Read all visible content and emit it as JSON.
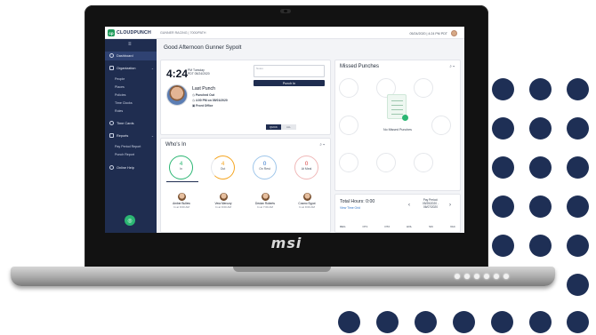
{
  "device": {
    "brand": "msi"
  },
  "app": {
    "logo_mark": "cp",
    "logo_text": "CLOUDPUNCH",
    "breadcrumb": "GUNNER RACING | 7000/PATH",
    "datetime": "05/24/2020 | 4:24 PM PDT",
    "greeting": "Good Afternoon Gunner Sypolt"
  },
  "sidebar": {
    "menu_glyph": "≡",
    "items": [
      {
        "label": "Dashboard"
      },
      {
        "label": "Organization"
      },
      {
        "label": "People"
      },
      {
        "label": "Places"
      },
      {
        "label": "Policies"
      },
      {
        "label": "Time Clocks"
      },
      {
        "label": "Roles"
      },
      {
        "label": "Time Cards"
      },
      {
        "label": "Reports"
      },
      {
        "label": "Pay Period Report"
      },
      {
        "label": "Punch Report"
      },
      {
        "label": "Online Help"
      }
    ]
  },
  "punch_card": {
    "time": "4:24",
    "ampm_tz": "PM  Tuesday",
    "date_line": "PDT  05/24/2020",
    "last_punch_title": "Last Punch",
    "status": "Punched Out",
    "when": "4:00 PM on 05/01/2020",
    "location": "Front Office",
    "notes_placeholder": "Notes",
    "punch_button": "Punch In",
    "toggle": [
      "QUICK",
      "ALL"
    ]
  },
  "whos_in": {
    "title": "Who's In",
    "stats": [
      {
        "value": "4",
        "label": "In"
      },
      {
        "value": "4",
        "label": "Out"
      },
      {
        "value": "0",
        "label": "On Rest"
      },
      {
        "value": "0",
        "label": "At Meal"
      }
    ],
    "people": [
      {
        "name": "Amber Bullew",
        "time": "In at 9:00 AM"
      },
      {
        "name": "Vera Mercury",
        "time": "In at 9:00 AM"
      },
      {
        "name": "Declan Roberts",
        "time": "In at 7:00 AM"
      },
      {
        "name": "Cosmo Sypot",
        "time": "In at 9:00 AM"
      }
    ]
  },
  "missed_punches": {
    "title": "Missed Punches",
    "empty_text": "No Missed Punches"
  },
  "total_hours": {
    "title": "Total Hours: 0:00",
    "link": "View Time Grid",
    "period_title": "Pay Period:",
    "period_from": "05/25/2020 -",
    "period_to": "06/07/2020",
    "columns": [
      "REG",
      "OT1",
      "OT2",
      "HOL",
      "SIC",
      "VAC"
    ]
  },
  "colors": {
    "navy": "#1f2d50",
    "green": "#2bb673",
    "orange": "#f5a623",
    "dots": "#1e2f55"
  }
}
